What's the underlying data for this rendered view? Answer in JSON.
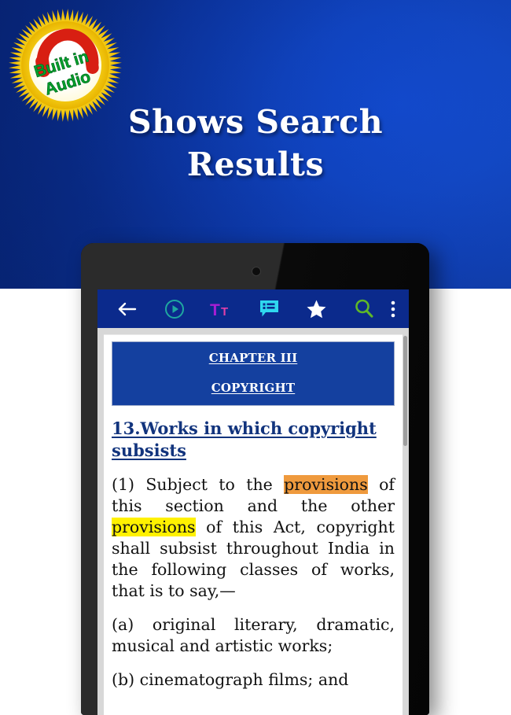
{
  "promo": {
    "headline": "Shows Search\nResults",
    "badge": {
      "line1": "Built in",
      "line2": "Audio",
      "icon": "headphones-icon",
      "burst_color": "#f5c400",
      "center_color": "#ffffff",
      "headphones_color": "#d81f12",
      "text_color": "#00a02c"
    },
    "background_color": "#0c37a6"
  },
  "device": {
    "type": "tablet",
    "bezel_color": "#0b0b0b"
  },
  "app": {
    "toolbar": {
      "background_color": "#0b2a8c",
      "items": [
        {
          "name": "back-button",
          "icon": "arrow-left-icon",
          "color": "#ffffff"
        },
        {
          "name": "play-button",
          "icon": "play-circle-icon",
          "color": "#1fa8a0"
        },
        {
          "name": "text-size-button",
          "icon": "text-size-icon",
          "color": "#c21fd6"
        },
        {
          "name": "notes-button",
          "icon": "notes-bubble-icon",
          "color": "#2fd8ef"
        },
        {
          "name": "bookmark-button",
          "icon": "star-icon",
          "color": "#ffffff"
        },
        {
          "name": "search-button",
          "icon": "search-icon",
          "color": "#5fb828"
        },
        {
          "name": "overflow-menu-button",
          "icon": "more-vertical-icon",
          "color": "#ffffff"
        }
      ]
    },
    "document": {
      "chapter_box": {
        "background_color": "#14409f",
        "title": "CHAPTER III",
        "subtitle": "COPYRIGHT"
      },
      "section_heading": "13.Works in which copyright subsists",
      "paragraphs": [
        {
          "id": "para-1",
          "segments": [
            {
              "text": "(1) Subject to the ",
              "highlight": "none"
            },
            {
              "text": "provisions",
              "highlight": "orange"
            },
            {
              "text": " of this section and the other ",
              "highlight": "none"
            },
            {
              "text": "provisions",
              "highlight": "yellow"
            },
            {
              "text": " of this Act, copyright shall subsist throughout India in the following classes of works, that is to say,—",
              "highlight": "none"
            }
          ]
        },
        {
          "id": "para-a",
          "segments": [
            {
              "text": "(a) original literary, dramatic, musical and artistic works;",
              "highlight": "none"
            }
          ]
        },
        {
          "id": "para-b",
          "segments": [
            {
              "text": "(b) cinematograph films; and",
              "highlight": "none"
            }
          ]
        }
      ],
      "highlight_colors": {
        "current_match": "#ef9a3d",
        "other_match": "#fff100"
      },
      "heading_color": "#12347d"
    },
    "scrollbar": {
      "name": "document-scrollbar",
      "thumb_color": "#9e9e9e"
    }
  }
}
